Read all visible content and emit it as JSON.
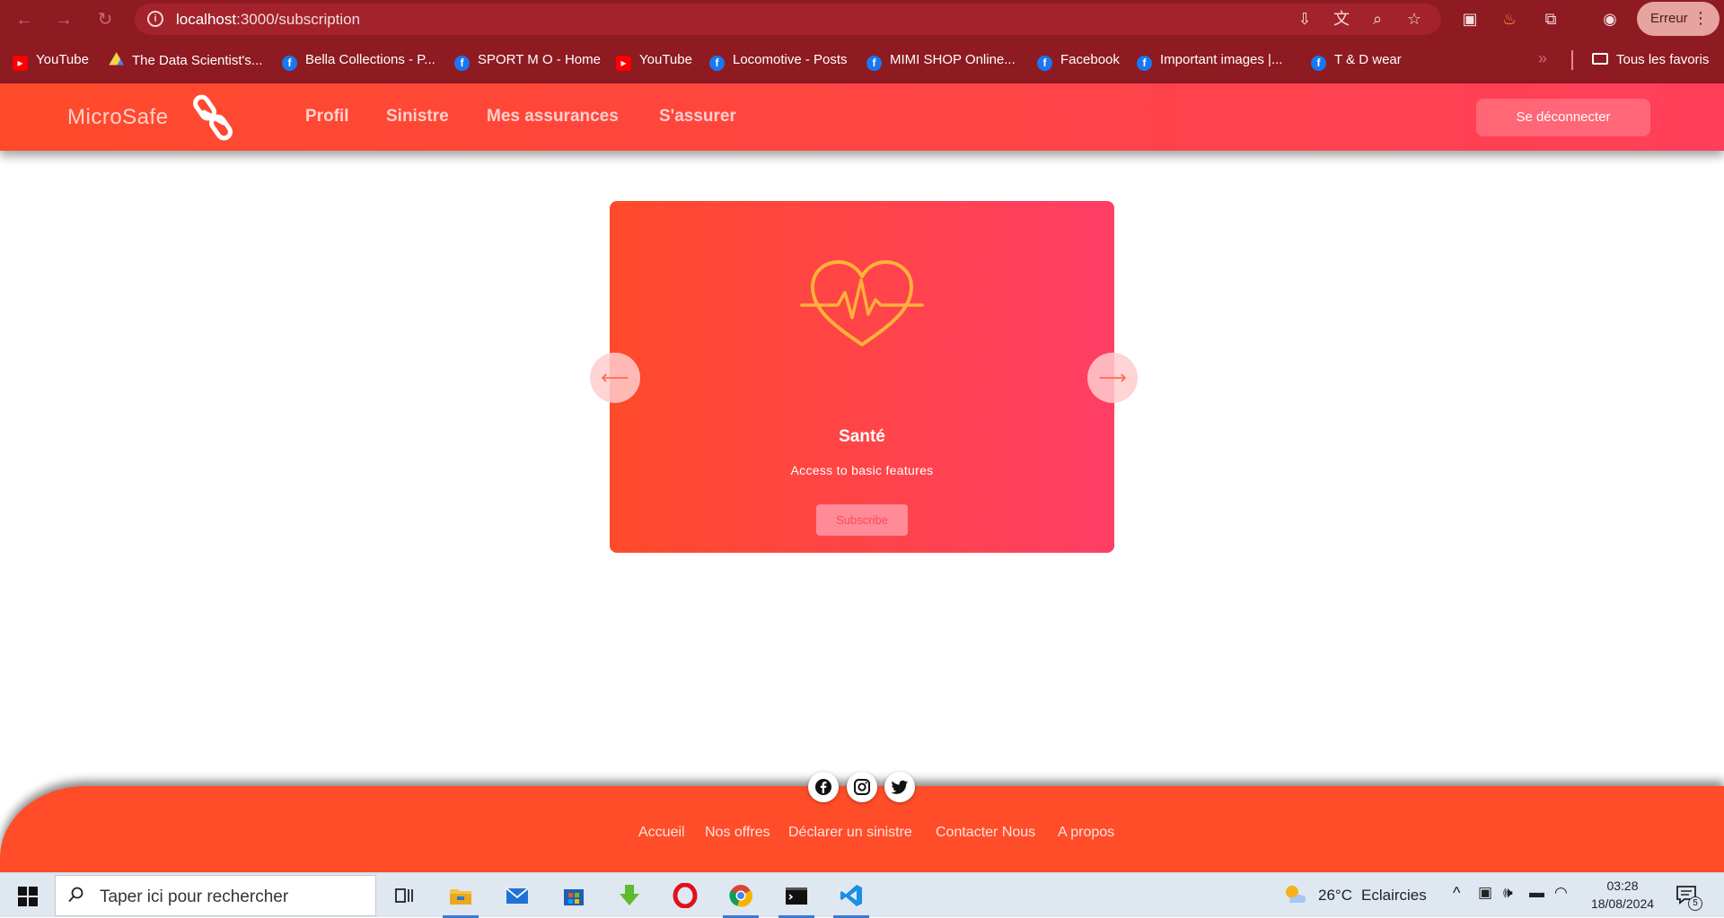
{
  "browser": {
    "url_host": "localhost",
    "url_path": ":3000/subscription",
    "profile_label": "Erreur",
    "bookmarks": [
      {
        "label": "YouTube",
        "icon": "youtube-icon"
      },
      {
        "label": "The Data Scientist's...",
        "icon": "google-drive-icon"
      },
      {
        "label": "Bella Collections - P...",
        "icon": "facebook-icon"
      },
      {
        "label": "SPORT M O - Home",
        "icon": "facebook-icon"
      },
      {
        "label": "YouTube",
        "icon": "youtube-icon"
      },
      {
        "label": "Locomotive - Posts",
        "icon": "facebook-icon"
      },
      {
        "label": "MIMI SHOP Online...",
        "icon": "facebook-icon"
      },
      {
        "label": "Facebook",
        "icon": "facebook-icon"
      },
      {
        "label": "Important images |...",
        "icon": "facebook-icon"
      },
      {
        "label": "T & D wear",
        "icon": "facebook-icon"
      }
    ],
    "all_bookmarks_label": "Tous les favoris"
  },
  "header": {
    "brand": "MicroSafe",
    "nav": [
      "Profil",
      "Sinistre",
      "Mes assurances",
      "S'assurer"
    ],
    "logout_label": "Se déconnecter"
  },
  "card": {
    "title": "Santé",
    "description": "Access to basic features",
    "button_label": "Subscribe",
    "icon": "heart-pulse-icon",
    "prev_arrow": "⟵",
    "next_arrow": "⟶"
  },
  "footer": {
    "social": [
      "facebook-icon",
      "instagram-icon",
      "twitter-icon"
    ],
    "links": [
      "Accueil",
      "Nos offres",
      "Déclarer un sinistre",
      "Contacter Nous",
      "A propos"
    ]
  },
  "taskbar": {
    "search_placeholder": "Taper ici pour rechercher",
    "weather": "26°C",
    "weather_desc": "Eclaircies",
    "time": "03:28",
    "date": "18/08/2024",
    "notifications": "5"
  },
  "colors": {
    "chrome": "#8e1a22",
    "accent_start": "#ff4a2a",
    "accent_end": "#ff3f5a",
    "footer": "#ff4d2a"
  }
}
